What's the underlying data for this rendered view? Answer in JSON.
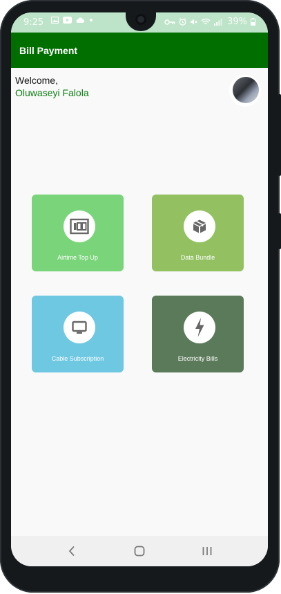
{
  "status_bar": {
    "time": "9:25",
    "battery": "39%"
  },
  "app_bar": {
    "title": "Bill Payment"
  },
  "greeting": {
    "welcome": "Welcome,",
    "name": "Oluwaseyi Falola"
  },
  "services": [
    {
      "label": "Airtime Top Up",
      "icon": "airtime-icon",
      "color": "#7ad57a"
    },
    {
      "label": "Data Bundle",
      "icon": "box-icon",
      "color": "#93c162"
    },
    {
      "label": "Cable Subscription",
      "icon": "tv-icon",
      "color": "#6fc8e2"
    },
    {
      "label": "Electricity Bills",
      "icon": "bolt-icon",
      "color": "#5b7a5a"
    }
  ],
  "colors": {
    "app_bar": "#006f00",
    "status_bar": "#bde4c8",
    "name_text": "#0c7c10",
    "background": "#f9f9f9"
  }
}
